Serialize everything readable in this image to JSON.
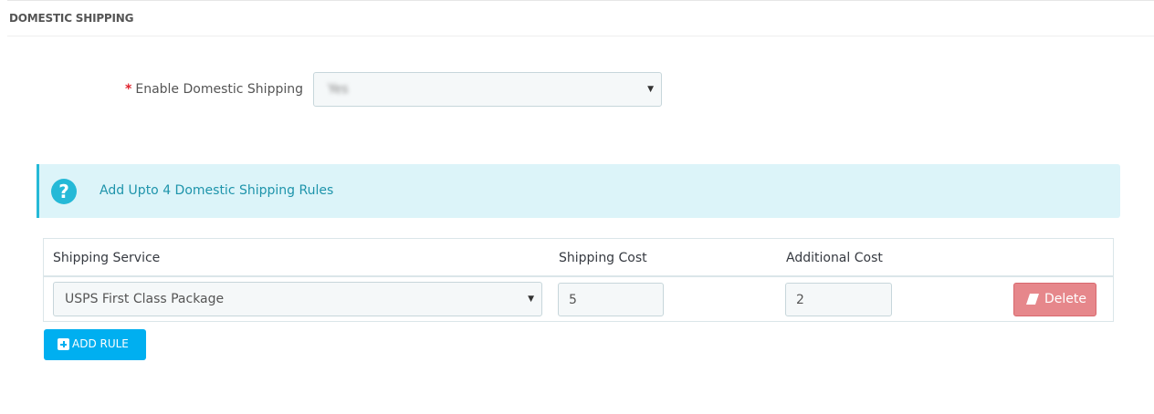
{
  "panel": {
    "title": "DOMESTIC SHIPPING"
  },
  "enable_field": {
    "required_marker": "*",
    "label": "Enable Domestic Shipping",
    "selected_value": "Yes"
  },
  "alert": {
    "icon": "question-icon",
    "icon_glyph": "?",
    "text": "Add Upto 4 Domestic Shipping Rules"
  },
  "rules_table": {
    "headers": [
      "Shipping Service",
      "Shipping Cost",
      "Additional Cost"
    ],
    "rows": [
      {
        "service": "USPS First Class Package",
        "cost": "5",
        "additional_cost": "2",
        "delete_label": "Delete"
      }
    ]
  },
  "add_rule_button": {
    "label": "ADD RULE"
  },
  "colors": {
    "accent": "#25b9d7",
    "primary_button": "#00aff0",
    "delete_button": "#e6878b",
    "required": "#e0242e"
  }
}
